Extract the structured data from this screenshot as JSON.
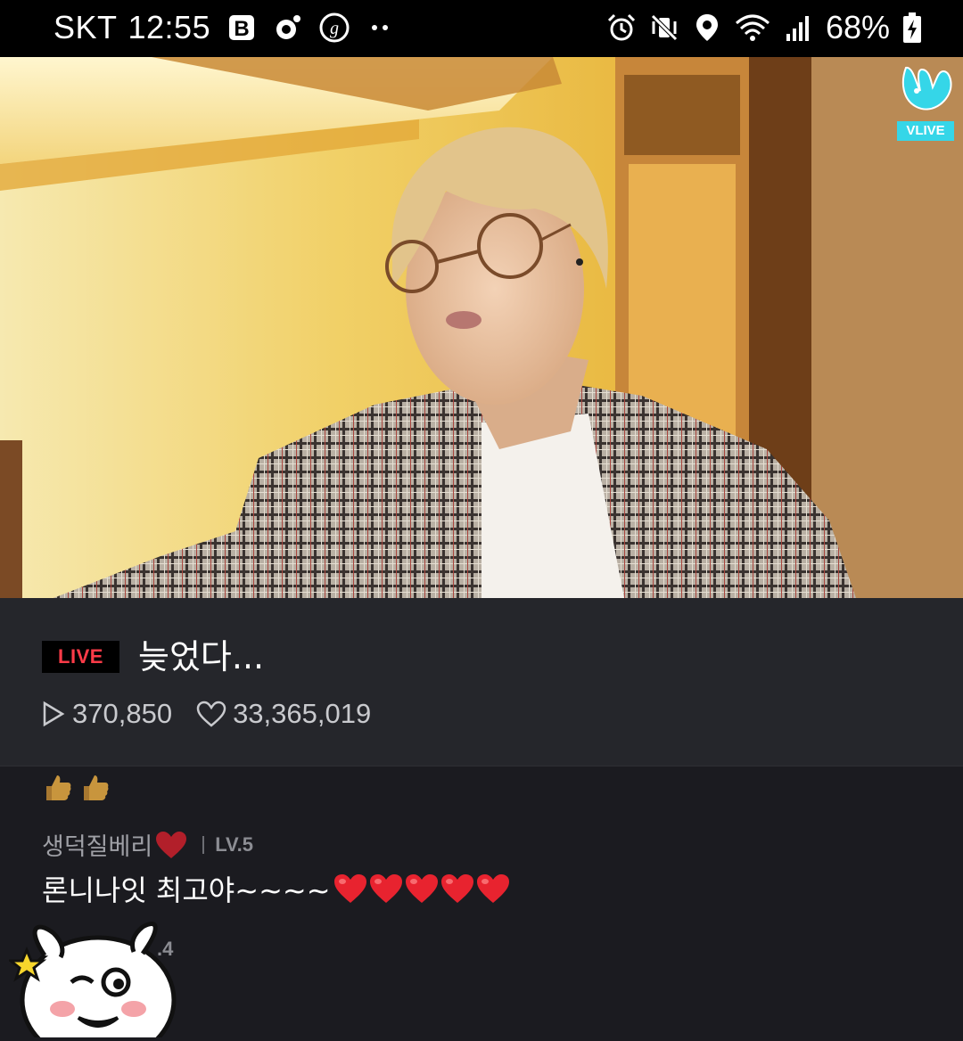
{
  "status_bar": {
    "carrier": "SKT",
    "time": "12:55",
    "notification_icons": [
      "blog-b-icon",
      "record-icon",
      "g-circle-icon",
      "more-dots-icon"
    ],
    "system_icons": [
      "alarm-icon",
      "vibrate-mute-icon",
      "location-icon",
      "wifi-icon",
      "signal-icon",
      "battery-charging-icon"
    ],
    "battery": "68%"
  },
  "video": {
    "watermark": "VLIVE"
  },
  "broadcast": {
    "live_label": "LIVE",
    "title": "늦었다...",
    "play_count": "370,850",
    "like_count": "33,365,019"
  },
  "chat": {
    "emoji_row": [
      "thumbs-up-icon",
      "thumbs-up-icon"
    ],
    "comments": [
      {
        "username": "생덕질베리",
        "level": "LV.5",
        "message": "론니나잇 최고야~~~~",
        "hearts": 5
      }
    ],
    "next_level_partial": ".4"
  },
  "colors": {
    "live_red": "#ff3b48",
    "panel_bg": "#25262b",
    "chat_bg": "#1b1b20",
    "heart_red": "#e8232f",
    "vlive_cyan": "#35d6e8"
  }
}
